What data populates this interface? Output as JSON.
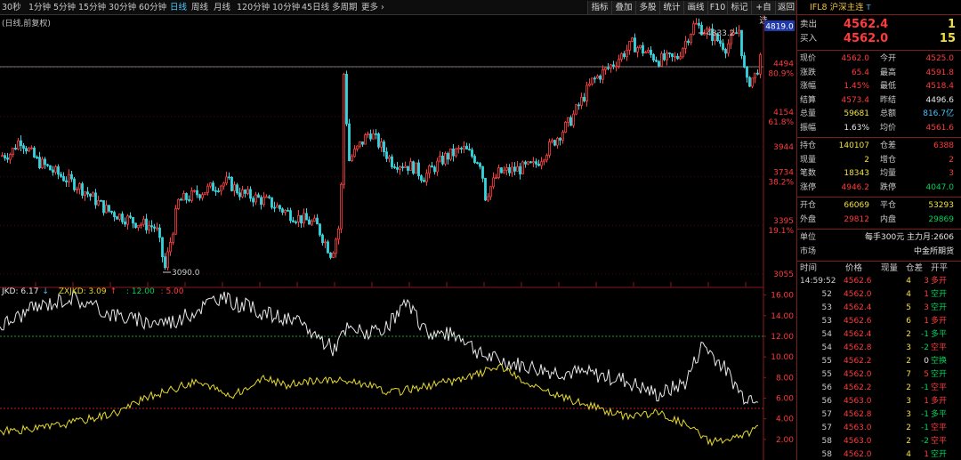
{
  "toolbar": {
    "periods": [
      "30秒",
      "1分钟",
      "5分钟",
      "15分钟",
      "30分钟",
      "60分钟",
      "日线",
      "周线",
      "月线",
      "120分钟",
      "10分钟",
      "45日线",
      "多周期",
      "更多 ›"
    ],
    "active_period": "日线",
    "tools": [
      "指标",
      "叠加",
      "多股",
      "统计",
      "画线",
      "F10",
      "标记",
      "+自选",
      "返回"
    ]
  },
  "kline": {
    "label": "(日线,前复权)",
    "high_marker": "4833.2",
    "low_marker": "3090.0",
    "current_price_tag": "4819.0",
    "axis": [
      {
        "price": "4494",
        "pct": "80.9%"
      },
      {
        "price": "4154",
        "pct": "61.8%"
      },
      {
        "price": "3944",
        "pct": ""
      },
      {
        "price": "3734",
        "pct": "38.2%"
      },
      {
        "price": "3395",
        "pct": "19.1%"
      },
      {
        "price": "3055",
        "pct": ""
      }
    ]
  },
  "indicator": {
    "jkd": "JKD: 6.17",
    "zxjkd": "ZXJKD: 3.09",
    "l1": ": 12.00",
    "l2": ": 5.00",
    "axis": [
      "16.00",
      "14.00",
      "12.00",
      "10.00",
      "8.00",
      "6.00",
      "4.00",
      "2.00"
    ]
  },
  "quote": {
    "symbol": "IFL8 沪深主连",
    "symbol_sup": "T",
    "sell_label": "卖出",
    "sell_price": "4562.4",
    "sell_vol": "1",
    "buy_label": "买入",
    "buy_price": "4562.0",
    "buy_vol": "15",
    "rows1": [
      {
        "l1": "现价",
        "v1": "4562.0",
        "c1": "red",
        "l2": "今开",
        "v2": "4525.0",
        "c2": "red"
      },
      {
        "l1": "涨跌",
        "v1": "65.4",
        "c1": "red",
        "l2": "最高",
        "v2": "4591.8",
        "c2": "red"
      },
      {
        "l1": "涨幅",
        "v1": "1.45%",
        "c1": "red",
        "l2": "最低",
        "v2": "4518.4",
        "c2": "red"
      },
      {
        "l1": "结算",
        "v1": "4573.4",
        "c1": "red",
        "l2": "昨结",
        "v2": "4496.6",
        "c2": "white"
      },
      {
        "l1": "总量",
        "v1": "59681",
        "c1": "yellow",
        "l2": "总额",
        "v2": "816.7亿",
        "c2": "cyan"
      },
      {
        "l1": "振幅",
        "v1": "1.63%",
        "c1": "white",
        "l2": "均价",
        "v2": "4561.6",
        "c2": "red"
      }
    ],
    "rows2": [
      {
        "l1": "持仓",
        "v1": "140107",
        "c1": "yellow",
        "l2": "仓差",
        "v2": "6388",
        "c2": "red"
      },
      {
        "l1": "现量",
        "v1": "2",
        "c1": "yellow",
        "l2": "增仓",
        "v2": "2",
        "c2": "red"
      },
      {
        "l1": "笔数",
        "v1": "18343",
        "c1": "yellow",
        "l2": "均量",
        "v2": "3",
        "c2": "red"
      },
      {
        "l1": "涨停",
        "v1": "4946.2",
        "c1": "red",
        "l2": "跌停",
        "v2": "4047.0",
        "c2": "green"
      }
    ],
    "rows3": [
      {
        "l1": "开仓",
        "v1": "66069",
        "c1": "yellow",
        "l2": "平仓",
        "v2": "53293",
        "c2": "yellow"
      },
      {
        "l1": "外盘",
        "v1": "29812",
        "c1": "red",
        "l2": "内盘",
        "v2": "29869",
        "c2": "green"
      }
    ],
    "unit_label": "单位",
    "unit_value": "每手300元   主力月:2606",
    "market_label": "市场",
    "market_value": "中金所期货"
  },
  "ticks": {
    "headers": [
      "时间",
      "价格",
      "现量",
      "仓差",
      "开平"
    ],
    "rows": [
      {
        "t": "14:59:52",
        "p": "4562.6",
        "v": "4",
        "d": "3",
        "dc": "red",
        "k": "多开",
        "kc": "red"
      },
      {
        "t": "52",
        "p": "4562.0",
        "v": "4",
        "d": "1",
        "dc": "red",
        "k": "空开",
        "kc": "green"
      },
      {
        "t": "53",
        "p": "4562.4",
        "v": "5",
        "d": "3",
        "dc": "red",
        "k": "空开",
        "kc": "green"
      },
      {
        "t": "53",
        "p": "4562.6",
        "v": "6",
        "d": "1",
        "dc": "red",
        "k": "多开",
        "kc": "red"
      },
      {
        "t": "54",
        "p": "4562.4",
        "v": "2",
        "d": "-1",
        "dc": "green",
        "k": "多平",
        "kc": "green"
      },
      {
        "t": "54",
        "p": "4562.8",
        "v": "3",
        "d": "-2",
        "dc": "green",
        "k": "空平",
        "kc": "red"
      },
      {
        "t": "55",
        "p": "4562.2",
        "v": "2",
        "d": "0",
        "dc": "white",
        "k": "空换",
        "kc": "green"
      },
      {
        "t": "55",
        "p": "4562.0",
        "v": "7",
        "d": "5",
        "dc": "red",
        "k": "空开",
        "kc": "green"
      },
      {
        "t": "56",
        "p": "4562.2",
        "v": "2",
        "d": "-1",
        "dc": "green",
        "k": "空平",
        "kc": "red"
      },
      {
        "t": "56",
        "p": "4563.0",
        "v": "3",
        "d": "1",
        "dc": "red",
        "k": "多开",
        "kc": "red"
      },
      {
        "t": "57",
        "p": "4562.8",
        "v": "3",
        "d": "-1",
        "dc": "green",
        "k": "多平",
        "kc": "green"
      },
      {
        "t": "57",
        "p": "4563.0",
        "v": "2",
        "d": "-1",
        "dc": "green",
        "k": "空平",
        "kc": "red"
      },
      {
        "t": "58",
        "p": "4563.0",
        "v": "2",
        "d": "-2",
        "dc": "green",
        "k": "空平",
        "kc": "red"
      },
      {
        "t": "58",
        "p": "4562.0",
        "v": "4",
        "d": "1",
        "dc": "red",
        "k": "空开",
        "kc": "green"
      },
      {
        "t": "59",
        "p": "4562.0",
        "v": "5",
        "d": "5",
        "dc": "red",
        "k": "多开",
        "kc": "red"
      }
    ]
  },
  "colors": {
    "up": "#ff3b3b",
    "down": "#36d6e0",
    "jkd": "#e8e8e8",
    "zxjkd": "#e6d92a",
    "grid": "#8a1a1a"
  }
}
